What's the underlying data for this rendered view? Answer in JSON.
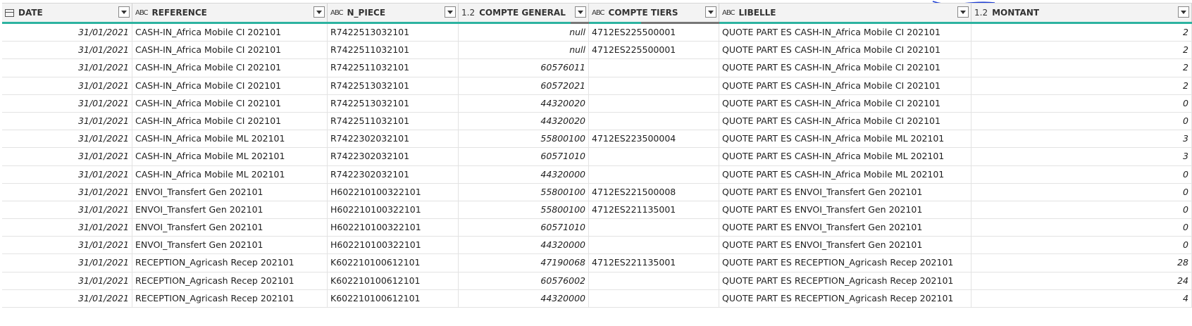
{
  "columns": [
    {
      "name": "DATE",
      "type": "date"
    },
    {
      "name": "REFERENCE",
      "type": "ABC"
    },
    {
      "name": "N_PIECE",
      "type": "ABC"
    },
    {
      "name": "COMPTE GENERAL",
      "type": "1.2"
    },
    {
      "name": "COMPTE TIERS",
      "type": "ABC"
    },
    {
      "name": "LIBELLE",
      "type": "ABC"
    },
    {
      "name": "MONTANT",
      "type": "1.2"
    }
  ],
  "colors": {
    "valid": "#2db3a0",
    "empty": "#777777",
    "header_bg": "#f3f3f3"
  },
  "rows": [
    [
      "31/01/2021",
      "CASH-IN_Africa Mobile CI 202101",
      "R7422513032101",
      "null",
      "4712ES225500001",
      "QUOTE PART ES CASH-IN_Africa Mobile CI 202101",
      "2"
    ],
    [
      "31/01/2021",
      "CASH-IN_Africa Mobile CI 202101",
      "R7422511032101",
      "null",
      "4712ES225500001",
      "QUOTE PART ES CASH-IN_Africa Mobile CI 202101",
      "2"
    ],
    [
      "31/01/2021",
      "CASH-IN_Africa Mobile CI 202101",
      "R7422511032101",
      "60576011",
      "",
      "QUOTE PART ES CASH-IN_Africa Mobile CI 202101",
      "2"
    ],
    [
      "31/01/2021",
      "CASH-IN_Africa Mobile CI 202101",
      "R7422513032101",
      "60572021",
      "",
      "QUOTE PART ES CASH-IN_Africa Mobile CI 202101",
      "2"
    ],
    [
      "31/01/2021",
      "CASH-IN_Africa Mobile CI 202101",
      "R7422513032101",
      "44320020",
      "",
      "QUOTE PART ES CASH-IN_Africa Mobile CI 202101",
      "0"
    ],
    [
      "31/01/2021",
      "CASH-IN_Africa Mobile CI 202101",
      "R7422511032101",
      "44320020",
      "",
      "QUOTE PART ES CASH-IN_Africa Mobile CI 202101",
      "0"
    ],
    [
      "31/01/2021",
      "CASH-IN_Africa Mobile ML 202101",
      "R7422302032101",
      "55800100",
      "4712ES223500004",
      "QUOTE PART ES CASH-IN_Africa Mobile ML 202101",
      "3"
    ],
    [
      "31/01/2021",
      "CASH-IN_Africa Mobile ML 202101",
      "R7422302032101",
      "60571010",
      "",
      "QUOTE PART ES CASH-IN_Africa Mobile ML 202101",
      "3"
    ],
    [
      "31/01/2021",
      "CASH-IN_Africa Mobile ML 202101",
      "R7422302032101",
      "44320000",
      "",
      "QUOTE PART ES CASH-IN_Africa Mobile ML 202101",
      "0"
    ],
    [
      "31/01/2021",
      "ENVOI_Transfert Gen 202101",
      "H602210100322101",
      "55800100",
      "4712ES221500008",
      "QUOTE PART ES ENVOI_Transfert Gen 202101",
      "0"
    ],
    [
      "31/01/2021",
      "ENVOI_Transfert Gen 202101",
      "H602210100322101",
      "55800100",
      "4712ES221135001",
      "QUOTE PART ES ENVOI_Transfert Gen 202101",
      "0"
    ],
    [
      "31/01/2021",
      "ENVOI_Transfert Gen 202101",
      "H602210100322101",
      "60571010",
      "",
      "QUOTE PART ES ENVOI_Transfert Gen 202101",
      "0"
    ],
    [
      "31/01/2021",
      "ENVOI_Transfert Gen 202101",
      "H602210100322101",
      "44320000",
      "",
      "QUOTE PART ES ENVOI_Transfert Gen 202101",
      "0"
    ],
    [
      "31/01/2021",
      "RECEPTION_Agricash Recep 202101",
      "K602210100612101",
      "47190068",
      "4712ES221135001",
      "QUOTE PART ES RECEPTION_Agricash Recep 202101",
      "28"
    ],
    [
      "31/01/2021",
      "RECEPTION_Agricash Recep 202101",
      "K602210100612101",
      "60576002",
      "",
      "QUOTE PART ES RECEPTION_Agricash Recep 202101",
      "24"
    ],
    [
      "31/01/2021",
      "RECEPTION_Agricash Recep 202101",
      "K602210100612101",
      "44320000",
      "",
      "QUOTE PART ES RECEPTION_Agricash Recep 202101",
      "4"
    ]
  ]
}
